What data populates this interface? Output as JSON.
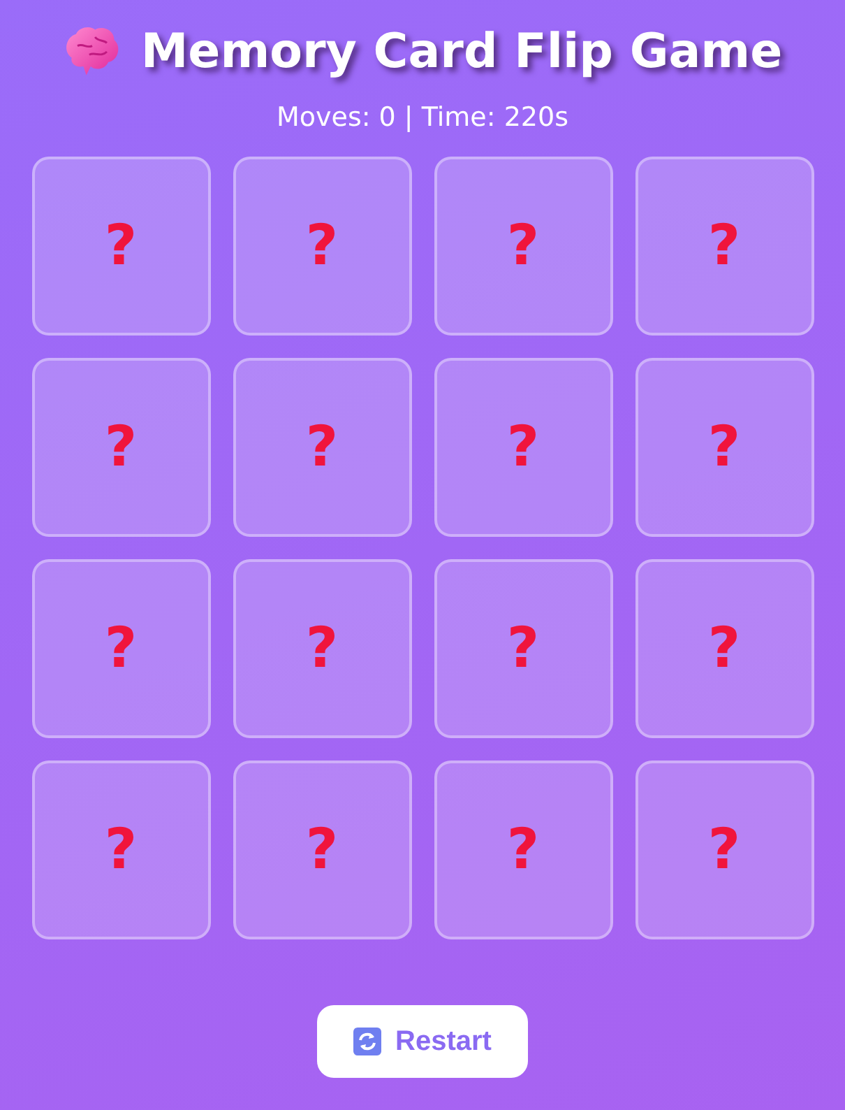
{
  "title": "Memory Card Flip Game",
  "stats": "Moves: 0 | Time: 220s",
  "cards": [
    {
      "face": "?",
      "flipped": false
    },
    {
      "face": "?",
      "flipped": false
    },
    {
      "face": "?",
      "flipped": false
    },
    {
      "face": "?",
      "flipped": false
    },
    {
      "face": "?",
      "flipped": false
    },
    {
      "face": "?",
      "flipped": false
    },
    {
      "face": "?",
      "flipped": false
    },
    {
      "face": "?",
      "flipped": false
    },
    {
      "face": "?",
      "flipped": false
    },
    {
      "face": "?",
      "flipped": false
    },
    {
      "face": "?",
      "flipped": false
    },
    {
      "face": "?",
      "flipped": false
    },
    {
      "face": "?",
      "flipped": false
    },
    {
      "face": "?",
      "flipped": false
    },
    {
      "face": "?",
      "flipped": false
    },
    {
      "face": "?",
      "flipped": false
    }
  ],
  "restart_button": "Restart"
}
